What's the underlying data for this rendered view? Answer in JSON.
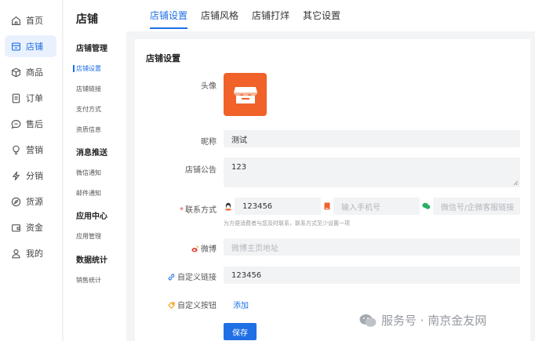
{
  "nav": {
    "items": [
      {
        "label": "首页",
        "icon": "home-icon",
        "active": false
      },
      {
        "label": "店铺",
        "icon": "store-icon",
        "active": true
      },
      {
        "label": "商品",
        "icon": "cube-icon",
        "active": false
      },
      {
        "label": "订单",
        "icon": "order-icon",
        "active": false
      },
      {
        "label": "售后",
        "icon": "chat-icon",
        "active": false
      },
      {
        "label": "营销",
        "icon": "bulb-icon",
        "active": false
      },
      {
        "label": "分销",
        "icon": "bolt-icon",
        "active": false
      },
      {
        "label": "货源",
        "icon": "compass-icon",
        "active": false
      },
      {
        "label": "资金",
        "icon": "wallet-icon",
        "active": false
      },
      {
        "label": "我的",
        "icon": "user-icon",
        "active": false
      }
    ]
  },
  "submenu": {
    "title": "店铺",
    "groups": [
      {
        "title": "店铺管理",
        "links": [
          "店铺设置",
          "店铺链接",
          "支付方式",
          "资质信息"
        ]
      },
      {
        "title": "消息推送",
        "links": [
          "微信通知",
          "邮件通知"
        ]
      },
      {
        "title": "应用中心",
        "links": [
          "应用管理"
        ]
      },
      {
        "title": "数据统计",
        "links": [
          "销售统计"
        ]
      }
    ],
    "active_link": "店铺设置"
  },
  "tabs": [
    "店铺设置",
    "店铺风格",
    "店铺打烊",
    "其它设置"
  ],
  "form": {
    "section_title": "店铺设置",
    "avatar_label": "头像",
    "nickname_label": "昵称",
    "nickname_value": "测试",
    "notice_label": "店铺公告",
    "notice_value": "123",
    "contact_label": "联系方式",
    "contact_qq_value": "123456",
    "contact_phone_placeholder": "输入手机号",
    "contact_wechat_placeholder": "微信号/企微客服链接",
    "contact_hint": "为方便消费者与您及时联系，联系方式至少设置一项",
    "weibo_label": "微博",
    "weibo_placeholder": "微博主页地址",
    "custom_link_label": "自定义链接",
    "custom_link_value": "123456",
    "custom_button_label": "自定义按钮",
    "add_label": "添加",
    "save_label": "保存"
  },
  "watermark": "服务号 · 南京金友网",
  "colors": {
    "accent": "#1f6fe5",
    "avatar": "#f0622a",
    "required": "#e5463b"
  }
}
